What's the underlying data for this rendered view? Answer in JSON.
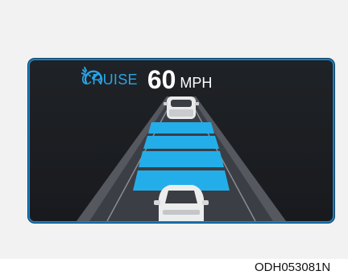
{
  "cluster": {
    "mode_label": "CRUISE",
    "speed_value": "60",
    "speed_unit": "MPH",
    "icon": "cruise-control-icon",
    "colors": {
      "accent": "#2aa3e6",
      "distance_bar": "#23aeea",
      "road": "#3c3f45",
      "background": "#1c1e22"
    },
    "distance_bars": {
      "lit": 4,
      "total": 4
    }
  },
  "image_code": "ODH053081N"
}
